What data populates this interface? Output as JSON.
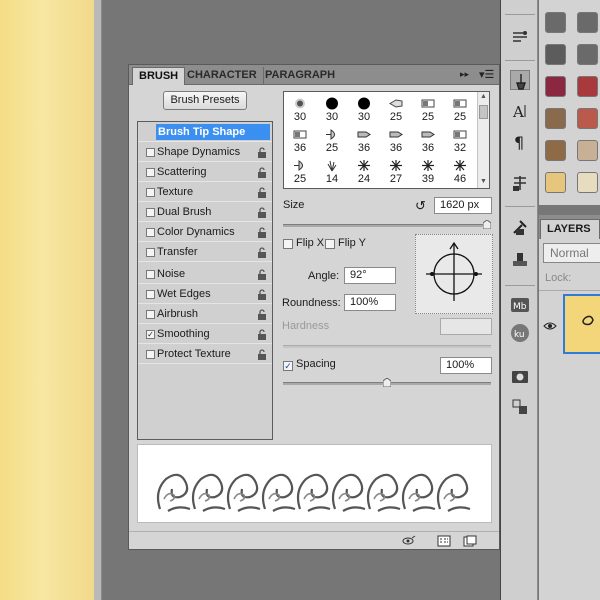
{
  "brush_panel": {
    "tabs": [
      "BRUSH",
      "CHARACTER",
      "PARAGRAPH"
    ],
    "presets_button": "Brush Presets",
    "options": [
      {
        "label": "Brush Tip Shape",
        "header": true
      },
      {
        "label": "Shape Dynamics",
        "checked": false
      },
      {
        "label": "Scattering",
        "checked": false
      },
      {
        "label": "Texture",
        "checked": false
      },
      {
        "label": "Dual Brush",
        "checked": false
      },
      {
        "label": "Color Dynamics",
        "checked": false
      },
      {
        "label": "Transfer",
        "checked": false
      },
      {
        "label": "Noise",
        "checked": false
      },
      {
        "label": "Wet Edges",
        "checked": false
      },
      {
        "label": "Airbrush",
        "checked": false
      },
      {
        "label": "Smoothing",
        "checked": true
      },
      {
        "label": "Protect Texture",
        "checked": false
      }
    ],
    "tip_rows": [
      [
        {
          "size": "30",
          "icon": "soft-dot"
        },
        {
          "size": "30",
          "icon": "hard-dot"
        },
        {
          "size": "30",
          "icon": "hard-dot"
        },
        {
          "size": "25",
          "icon": "bristle-brush"
        },
        {
          "size": "25",
          "icon": "square-brush"
        },
        {
          "size": "25",
          "icon": "square-brush"
        }
      ],
      [
        {
          "size": "36",
          "icon": "square-brush"
        },
        {
          "size": "25",
          "icon": "fan-brush"
        },
        {
          "size": "36",
          "icon": "flat-brush"
        },
        {
          "size": "36",
          "icon": "flat-brush"
        },
        {
          "size": "36",
          "icon": "flat-brush"
        },
        {
          "size": "32",
          "icon": "square-brush"
        }
      ],
      [
        {
          "size": "25",
          "icon": "fan-brush"
        },
        {
          "size": "14",
          "icon": "grass-brush"
        },
        {
          "size": "24",
          "icon": "scatter-brush"
        },
        {
          "size": "27",
          "icon": "scatter-brush"
        },
        {
          "size": "39",
          "icon": "scatter-brush"
        },
        {
          "size": "46",
          "icon": "scatter-brush"
        }
      ]
    ],
    "size_label": "Size",
    "size_value": "1620 px",
    "size_level": 0.98,
    "flip_x_label": "Flip X",
    "flip_y_label": "Flip Y",
    "angle_label": "Angle:",
    "angle_value": "92°",
    "roundness_label": "Roundness:",
    "roundness_value": "100%",
    "hardness_label": "Hardness",
    "spacing_label": "Spacing",
    "spacing_checked": true,
    "spacing_value": "100%",
    "spacing_level": 0.5
  },
  "layers_panel": {
    "tab": "LAYERS",
    "blend_mode": "Normal",
    "lock_label": "Lock:"
  },
  "dock_icons": [
    "brush-settings-icon",
    "brush-panel-icon",
    "character-icon",
    "paragraph-icon",
    "clone-source-icon",
    "tool-presets-icon",
    "stamp-icon",
    "mini-bridge-icon",
    "kuler-icon",
    "camera-icon",
    "transform-icon"
  ],
  "colors": {
    "accent": "#3b8ff0",
    "panel_bg": "#d5d5d5",
    "workspace": "#767676",
    "canvas_paper": "#f4dd86"
  },
  "swatches": [
    "#6a6a6a",
    "#6a6a6a",
    "#5c5c5c",
    "#6a6a6a",
    "#8b2740",
    "#a83a3e",
    "#8a6a4c",
    "#b95a4c",
    "#8f6a46",
    "#c7b095",
    "#e6c67c",
    "#e8dcc0"
  ]
}
